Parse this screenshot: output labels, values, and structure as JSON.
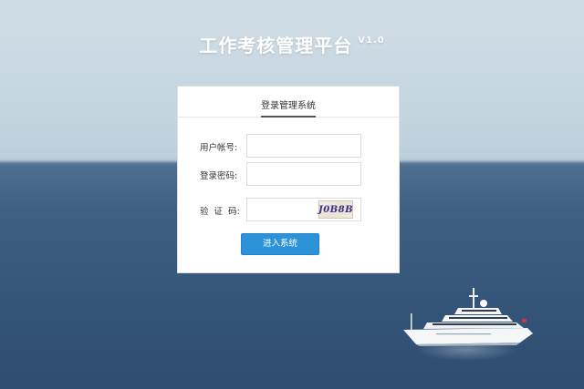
{
  "app": {
    "title": "工作考核管理平台",
    "version": "V1.0"
  },
  "login": {
    "tab_label": "登录管理系统",
    "username_label": "用户帐号:",
    "username_value": "",
    "password_label": "登录密码:",
    "password_value": "",
    "captcha_label": "验  证  码:",
    "captcha_value": "",
    "captcha_image_text": "J0B8B",
    "submit_label": "进入系统"
  },
  "colors": {
    "button_bg": "#2d93d9",
    "background_sky": "#c8d8e2",
    "background_sea": "#3f5f82"
  }
}
